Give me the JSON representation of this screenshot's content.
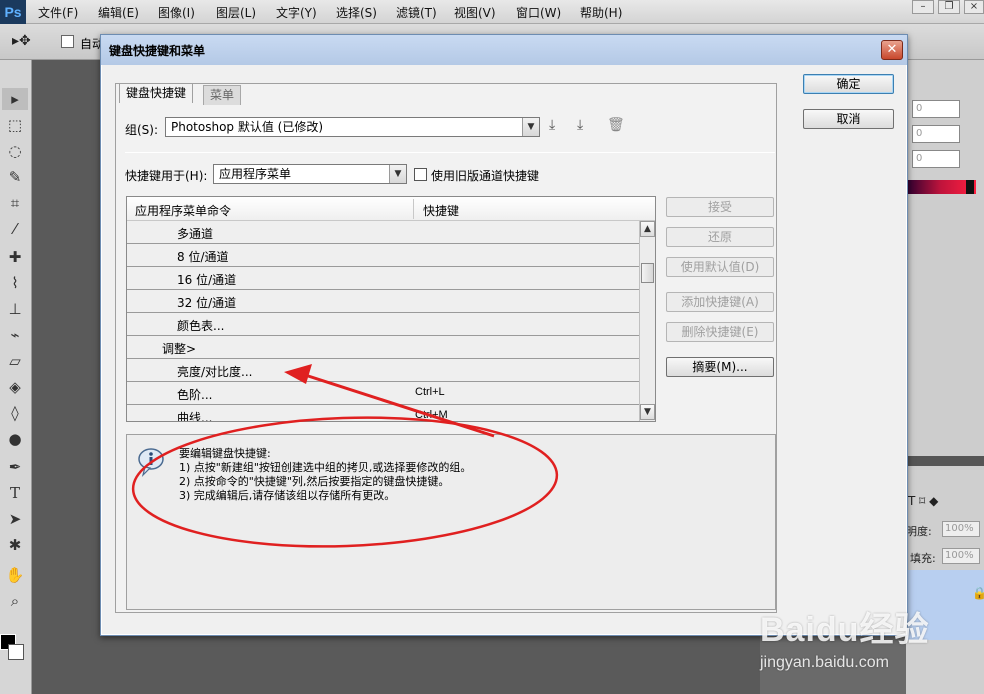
{
  "app": {
    "logo": "Ps",
    "menus": [
      "文件(F)",
      "编辑(E)",
      "图像(I)",
      "图层(L)",
      "文字(Y)",
      "选择(S)",
      "滤镜(T)",
      "视图(V)",
      "窗口(W)",
      "帮助(H)"
    ],
    "options_bar": {
      "auto_select_label": "自动"
    }
  },
  "dialog": {
    "title": "键盘快捷键和菜单",
    "tabs": [
      "键盘快捷键",
      "菜单"
    ],
    "set_label": "组(S):",
    "set_value": "Photoshop 默认值 (已修改)",
    "shortcuts_for_label": "快捷键用于(H):",
    "shortcuts_for_value": "应用程序菜单",
    "legacy_label": "使用旧版通道快捷键",
    "table": {
      "headers": [
        "应用程序菜单命令",
        "快捷键"
      ],
      "rows": [
        {
          "command": "多通道",
          "shortcut": "",
          "indent": 2
        },
        {
          "command": "8 位/通道",
          "shortcut": "",
          "indent": 2
        },
        {
          "command": "16 位/通道",
          "shortcut": "",
          "indent": 2
        },
        {
          "command": "32 位/通道",
          "shortcut": "",
          "indent": 2
        },
        {
          "command": "颜色表...",
          "shortcut": "",
          "indent": 2
        },
        {
          "command": "调整>",
          "shortcut": "",
          "indent": 1
        },
        {
          "command": "亮度/对比度...",
          "shortcut": "",
          "indent": 2
        },
        {
          "command": "色阶...",
          "shortcut": "Ctrl+L",
          "indent": 2
        },
        {
          "command": "曲线...",
          "shortcut": "Ctrl+M",
          "indent": 2
        }
      ]
    },
    "buttons": {
      "ok": "确定",
      "cancel": "取消",
      "accept": "接受",
      "undo": "还原",
      "use_default": "使用默认值(D)",
      "add_shortcut": "添加快捷键(A)",
      "delete_shortcut": "删除快捷键(E)",
      "summary": "摘要(M)..."
    },
    "info": {
      "lines": [
        "要编辑键盘快捷键:",
        "1) 点按\"新建组\"按钮创建选中组的拷贝,或选择要修改的组。",
        "2) 点按命令的\"快捷键\"列,然后按要指定的键盘快捷键。",
        "3) 完成编辑后,请存储该组以存储所有更改。"
      ]
    }
  },
  "right_panel": {
    "fields": [
      "0",
      "0",
      "0"
    ],
    "opacity_label": "明度:",
    "opacity_value": "100%",
    "fill_label": "填充:",
    "fill_value": "100%"
  },
  "watermark": {
    "brand": "Baidu经验",
    "url": "jingyan.baidu.com"
  },
  "colors": {
    "annotation": "#e02020",
    "dialog_titlebar": "#b4c9e6"
  }
}
